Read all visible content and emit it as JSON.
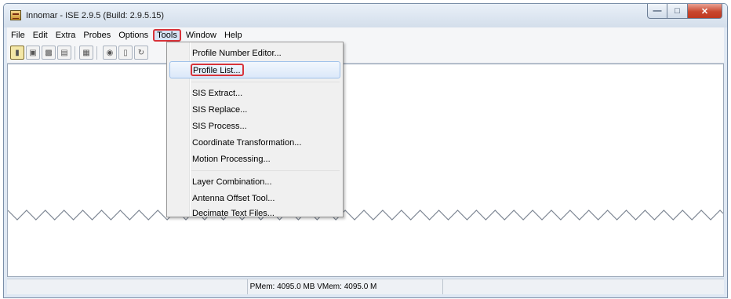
{
  "window": {
    "title": "Innomar - ISE 2.9.5 (Build: 2.9.5.15)"
  },
  "menubar": {
    "items": [
      "File",
      "Edit",
      "Extra",
      "Probes",
      "Options",
      "Tools",
      "Window",
      "Help"
    ],
    "open_item": "Tools"
  },
  "tools_menu": {
    "items": [
      "Profile Number Editor...",
      "Profile List...",
      "SIS Extract...",
      "SIS Replace...",
      "SIS Process...",
      "Coordinate Transformation...",
      "Motion Processing...",
      "Layer Combination...",
      "Antenna Offset Tool...",
      "Decimate Text Files..."
    ],
    "highlighted_item": "Profile List..."
  },
  "statusbar": {
    "memory": "PMem: 4095.0 MB VMem: 4095.0 M"
  },
  "colors": {
    "highlight_frame": "#d8333a",
    "menu_highlight": "#dbe8f9"
  }
}
